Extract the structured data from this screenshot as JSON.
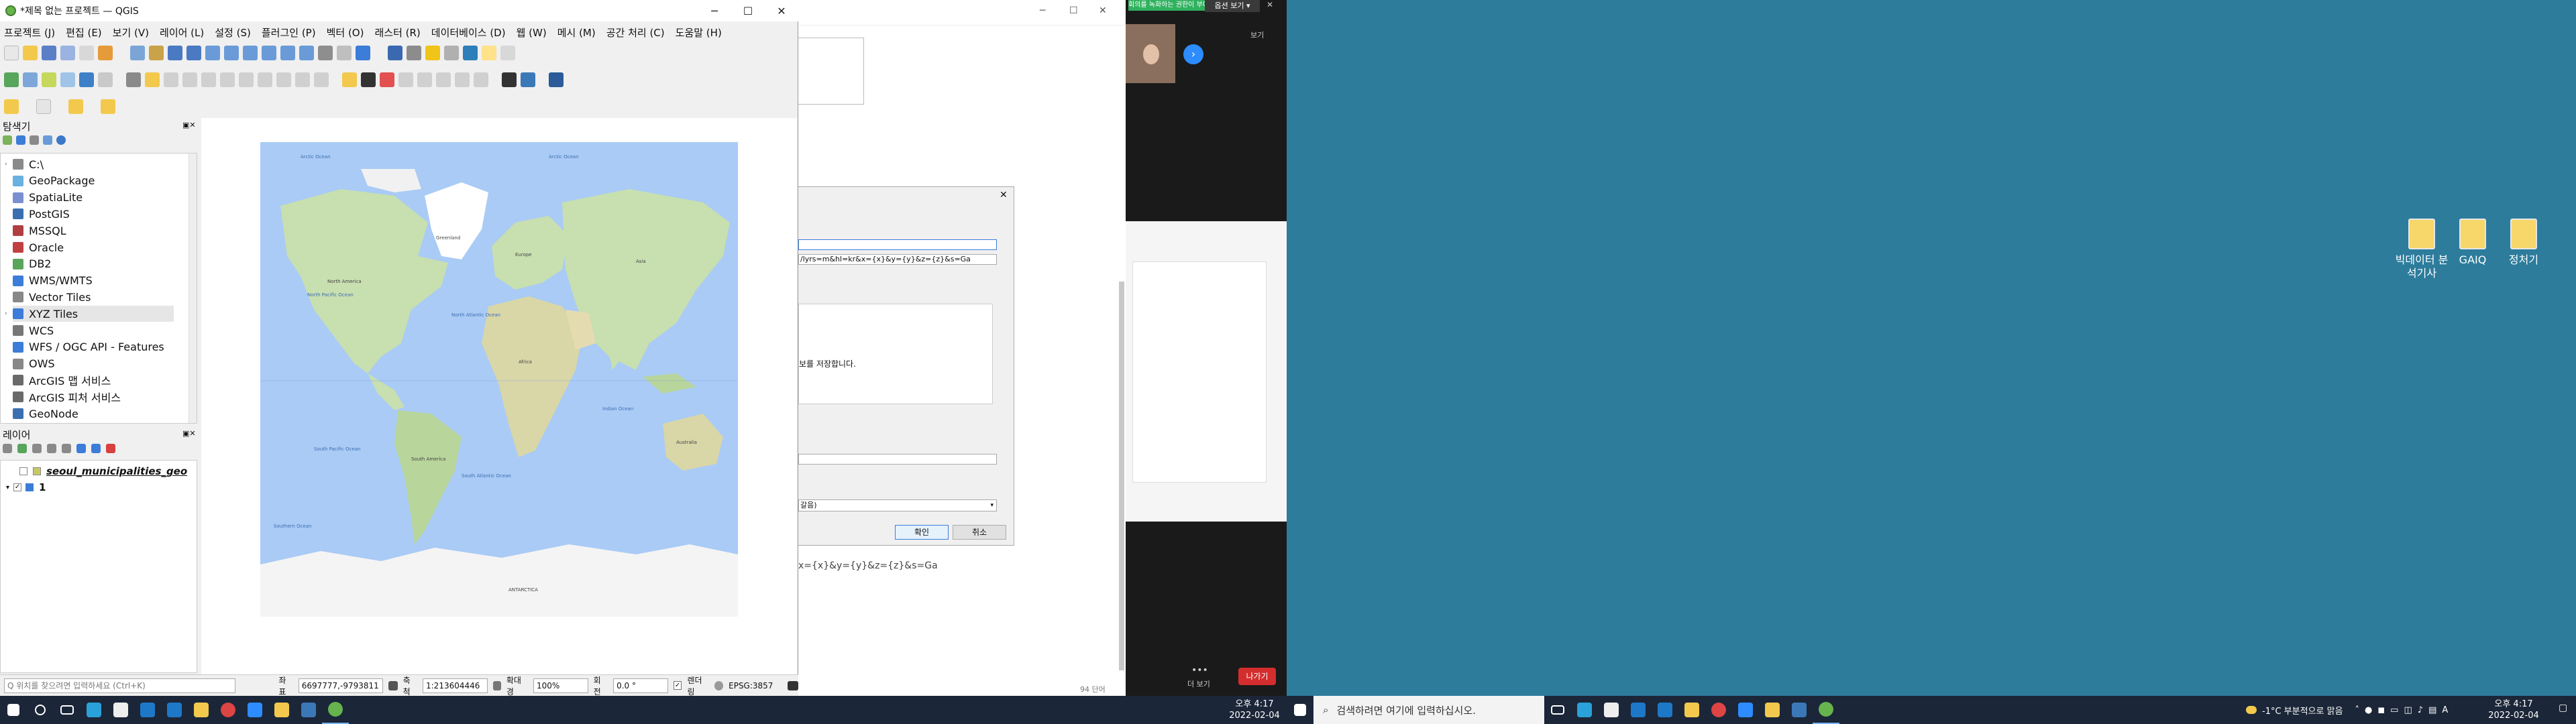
{
  "qgis": {
    "title": "*제목 없는 프로젝트 — QGIS",
    "menu": [
      "프로젝트 (J)",
      "편집 (E)",
      "보기 (V)",
      "레이어 (L)",
      "설정 (S)",
      "플러그인 (P)",
      "벡터 (O)",
      "래스터 (R)",
      "데이터베이스 (D)",
      "웹 (W)",
      "메시 (M)",
      "공간 처리 (C)",
      "도움말 (H)"
    ],
    "browser": {
      "title": "탐색기",
      "items": [
        "C:\\",
        "GeoPackage",
        "SpatiaLite",
        "PostGIS",
        "MSSQL",
        "Oracle",
        "DB2",
        "WMS/WMTS",
        "Vector Tiles",
        "XYZ Tiles",
        "WCS",
        "WFS / OGC API - Features",
        "OWS",
        "ArcGIS 맵 서비스",
        "ArcGIS 피처 서비스",
        "GeoNode"
      ]
    },
    "layers": {
      "title": "레이어",
      "items": [
        "seoul_municipalities_geo",
        "1"
      ]
    },
    "map_labels": {
      "north_pacific": "North Pacific Ocean",
      "north_atlantic": "North Atlantic Ocean",
      "south_pacific": "South Pacific Ocean",
      "south_atlantic": "South Atlantic Ocean",
      "indian": "Indian Ocean",
      "southern": "Southern Ocean",
      "antarctica": "ANTARCTICA",
      "arctic": "Arctic Ocean",
      "greenland": "Greenland",
      "north_america": "North America",
      "south_america": "South America",
      "europe": "Europe",
      "africa": "Africa",
      "asia": "Asia",
      "australia": "Australia"
    },
    "status": {
      "search_placeholder": "Q 위치를 찾으려면 입력하세요 (Ctrl+K)",
      "coord_label": "좌표",
      "coord_value": "6697777,-9793811",
      "scale_label": "축척",
      "scale_value": "1:213604446",
      "magnifier_label": "확대경",
      "magnifier_value": "100%",
      "rotation_label": "회전",
      "rotation_value": "0.0 °",
      "render_label": "렌더링",
      "crs": "EPSG:3857"
    }
  },
  "dialog_bg": {
    "url_field": "/lyrs=m&hl=kr&x={x}&y={y}&z={z}&s=Ga",
    "desc_text": "보를 저장합니다.",
    "dropdown": "갈음)",
    "ok": "확인",
    "cancel": "취소",
    "below_text": "x={x}&y={y}&z={z}&s=Ga",
    "page_counter": "94 단어"
  },
  "zoom": {
    "banner": "회의를 녹화하는 권한이 부여되었습니다",
    "view_button": "옵션 보기",
    "view_small": "보기",
    "more_label": "더 보기",
    "leave_button": "나가기"
  },
  "left_taskbar": {
    "time": "오후 4:17",
    "date": "2022-02-04"
  },
  "right_taskbar": {
    "search_placeholder": "검색하려면 여기에 입력하십시오.",
    "weather": "-1°C 부분적으로 맑음",
    "time": "오후 4:17",
    "date": "2022-02-04"
  },
  "desktop_icons": [
    "빅데이터 분석기사",
    "GAIQ",
    "정처기"
  ],
  "colors": {
    "desktop": "#2d7c9c",
    "taskbar": "#1b2638",
    "ocean": "#a9cbf5",
    "land": "#c8dfb0",
    "zoom_dark": "#1a1a1a",
    "leave_red": "#d32d2d",
    "zoom_banner_green": "#31b15f"
  }
}
